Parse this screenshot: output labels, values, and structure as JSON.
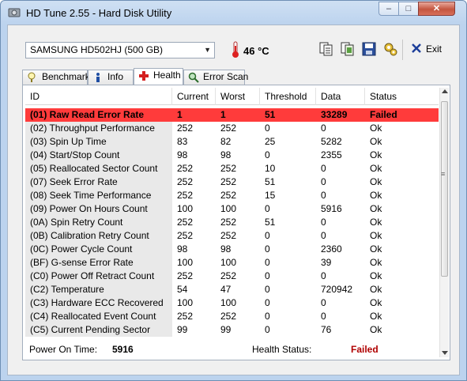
{
  "window": {
    "title": "HD Tune 2.55 - Hard Disk Utility",
    "controls": {
      "minimize": "–",
      "maximize": "□",
      "close": "✕"
    }
  },
  "toolbar": {
    "drive": "SAMSUNG HD502HJ (500 GB)",
    "temperature": "46 °C",
    "exit_label": "Exit",
    "icons": [
      "copy-text-icon",
      "copy-screenshot-icon",
      "save-icon",
      "options-icon",
      "exit-icon"
    ]
  },
  "tabs": [
    {
      "label": "Benchmark",
      "icon": "benchmark-icon",
      "active": false
    },
    {
      "label": "Info",
      "icon": "info-icon",
      "active": false
    },
    {
      "label": "Health",
      "icon": "health-icon",
      "active": true
    },
    {
      "label": "Error Scan",
      "icon": "error-scan-icon",
      "active": false
    }
  ],
  "table": {
    "columns": [
      "ID",
      "Current",
      "Worst",
      "Threshold",
      "Data",
      "Status"
    ],
    "rows": [
      [
        "(01) Raw Read Error Rate",
        "1",
        "1",
        "51",
        "33289",
        "Failed"
      ],
      [
        "(02) Throughput Performance",
        "252",
        "252",
        "0",
        "0",
        "Ok"
      ],
      [
        "(03) Spin Up Time",
        "83",
        "82",
        "25",
        "5282",
        "Ok"
      ],
      [
        "(04) Start/Stop Count",
        "98",
        "98",
        "0",
        "2355",
        "Ok"
      ],
      [
        "(05) Reallocated Sector Count",
        "252",
        "252",
        "10",
        "0",
        "Ok"
      ],
      [
        "(07) Seek Error Rate",
        "252",
        "252",
        "51",
        "0",
        "Ok"
      ],
      [
        "(08) Seek Time Performance",
        "252",
        "252",
        "15",
        "0",
        "Ok"
      ],
      [
        "(09) Power On Hours Count",
        "100",
        "100",
        "0",
        "5916",
        "Ok"
      ],
      [
        "(0A) Spin Retry Count",
        "252",
        "252",
        "51",
        "0",
        "Ok"
      ],
      [
        "(0B) Calibration Retry Count",
        "252",
        "252",
        "0",
        "0",
        "Ok"
      ],
      [
        "(0C) Power Cycle Count",
        "98",
        "98",
        "0",
        "2360",
        "Ok"
      ],
      [
        "(BF) G-sense Error Rate",
        "100",
        "100",
        "0",
        "39",
        "Ok"
      ],
      [
        "(C0) Power Off Retract Count",
        "252",
        "252",
        "0",
        "0",
        "Ok"
      ],
      [
        "(C2) Temperature",
        "54",
        "47",
        "0",
        "720942",
        "Ok"
      ],
      [
        "(C3) Hardware ECC Recovered",
        "100",
        "100",
        "0",
        "0",
        "Ok"
      ],
      [
        "(C4) Reallocated Event Count",
        "252",
        "252",
        "0",
        "0",
        "Ok"
      ],
      [
        "(C5) Current Pending Sector",
        "99",
        "99",
        "0",
        "76",
        "Ok"
      ]
    ],
    "failed_row_color": "#ff3b3b"
  },
  "footer": {
    "power_on_label": "Power On Time:",
    "power_on_value": "5916",
    "health_label": "Health Status:",
    "health_value": "Failed"
  }
}
